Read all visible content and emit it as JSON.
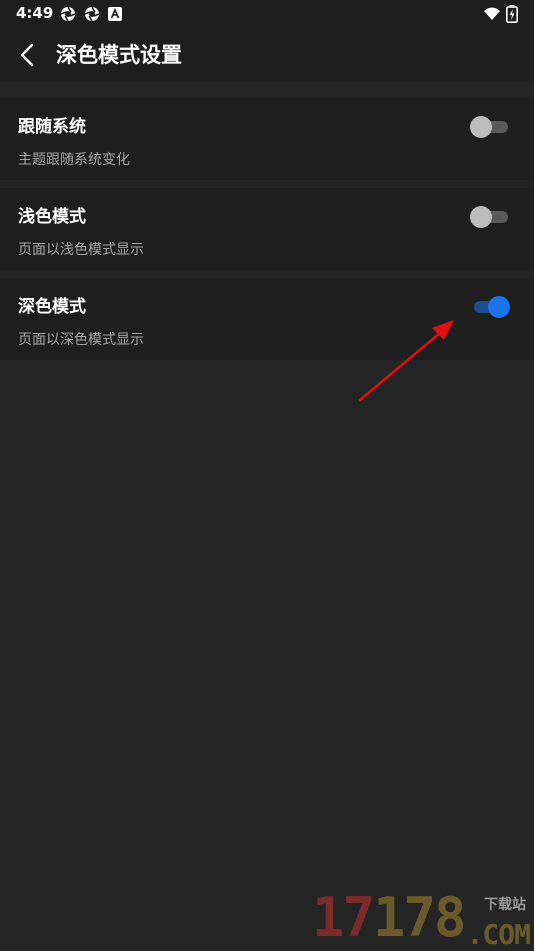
{
  "status_bar": {
    "time": "4:49",
    "icons": [
      "aperture-icon",
      "aperture-icon",
      "a-badge-icon",
      "wifi-icon",
      "battery-charging-icon"
    ]
  },
  "header": {
    "title": "深色模式设置",
    "back_icon": "chevron-left-icon"
  },
  "settings": [
    {
      "title": "跟随系统",
      "description": "主题跟随系统变化",
      "enabled": false
    },
    {
      "title": "浅色模式",
      "description": "页面以浅色模式显示",
      "enabled": false
    },
    {
      "title": "深色模式",
      "description": "页面以深色模式显示",
      "enabled": true
    }
  ],
  "colors": {
    "background": "#242424",
    "panel": "#1e1e1e",
    "accent": "#1a73e8",
    "annotation": "#e01010"
  },
  "watermark": {
    "digits": "17178",
    "label": "下载站",
    "domain": ".COM"
  }
}
